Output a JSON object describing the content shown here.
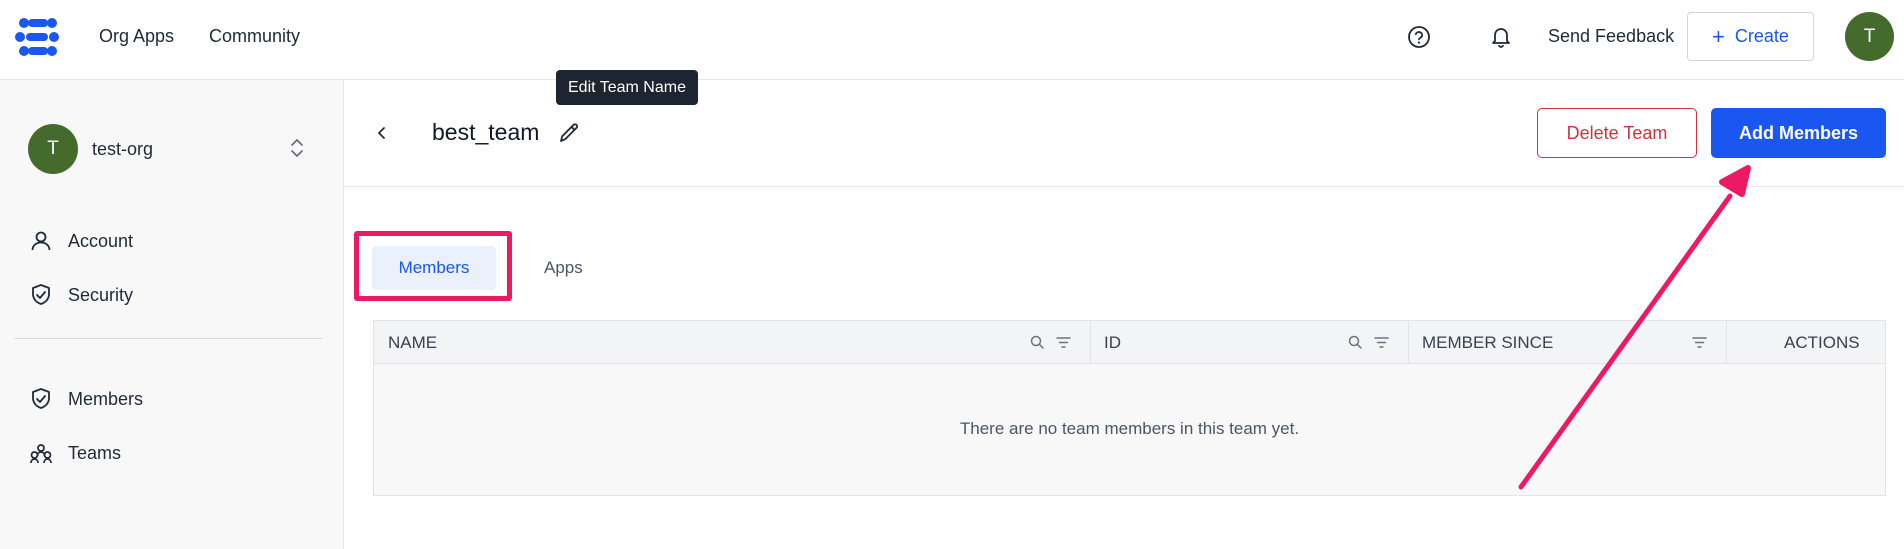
{
  "topbar": {
    "nav": [
      "Org Apps",
      "Community"
    ],
    "send_feedback": "Send Feedback",
    "create_label": "Create",
    "user_initial": "T"
  },
  "tooltip": {
    "text": "Edit Team Name"
  },
  "sidebar": {
    "org": {
      "initial": "T",
      "name": "test-org"
    },
    "items": [
      {
        "label": "Account",
        "icon": "user-icon"
      },
      {
        "label": "Security",
        "icon": "shield-check-icon"
      },
      {
        "label": "Members",
        "icon": "shield-check-icon"
      },
      {
        "label": "Teams",
        "icon": "teams-icon"
      }
    ]
  },
  "team": {
    "name": "best_team",
    "delete_label": "Delete Team",
    "add_members_label": "Add Members"
  },
  "tabs": [
    {
      "label": "Members",
      "active": true
    },
    {
      "label": "Apps",
      "active": false
    }
  ],
  "table": {
    "columns": [
      "NAME",
      "ID",
      "MEMBER SINCE",
      "ACTIONS"
    ],
    "empty_message": "There are no team members in this team yet."
  },
  "colors": {
    "accent": "#1a56f0",
    "danger": "#d0323f",
    "avatar": "#446b2c",
    "annotation": "#ec1a62"
  }
}
